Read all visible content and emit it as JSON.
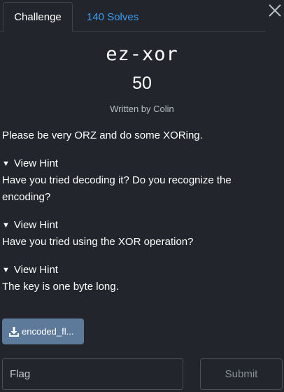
{
  "tabs": {
    "challenge_label": "Challenge",
    "solves_label": "140 Solves"
  },
  "challenge": {
    "name": "ez-xor",
    "points": "50",
    "author": "Written by Colin",
    "description": "Please be very ORZ and do some XORing."
  },
  "hints": [
    {
      "toggle": "View Hint",
      "text": "Have you tried decoding it? Do you recognize the encoding?"
    },
    {
      "toggle": "View Hint",
      "text": "Have you tried using the XOR operation?"
    },
    {
      "toggle": "View Hint",
      "text": "The key is one byte long."
    }
  ],
  "file": {
    "label": "encoded_fl..."
  },
  "submit_form": {
    "flag_placeholder": "Flag",
    "submit_label": "Submit"
  },
  "icons": {
    "close": "close-icon",
    "download": "download-icon",
    "hint_toggle": "triangle-down-icon"
  },
  "colors": {
    "background": "#22252b",
    "tab_link": "#3b9ef5",
    "file_button": "#5d7a9a"
  }
}
